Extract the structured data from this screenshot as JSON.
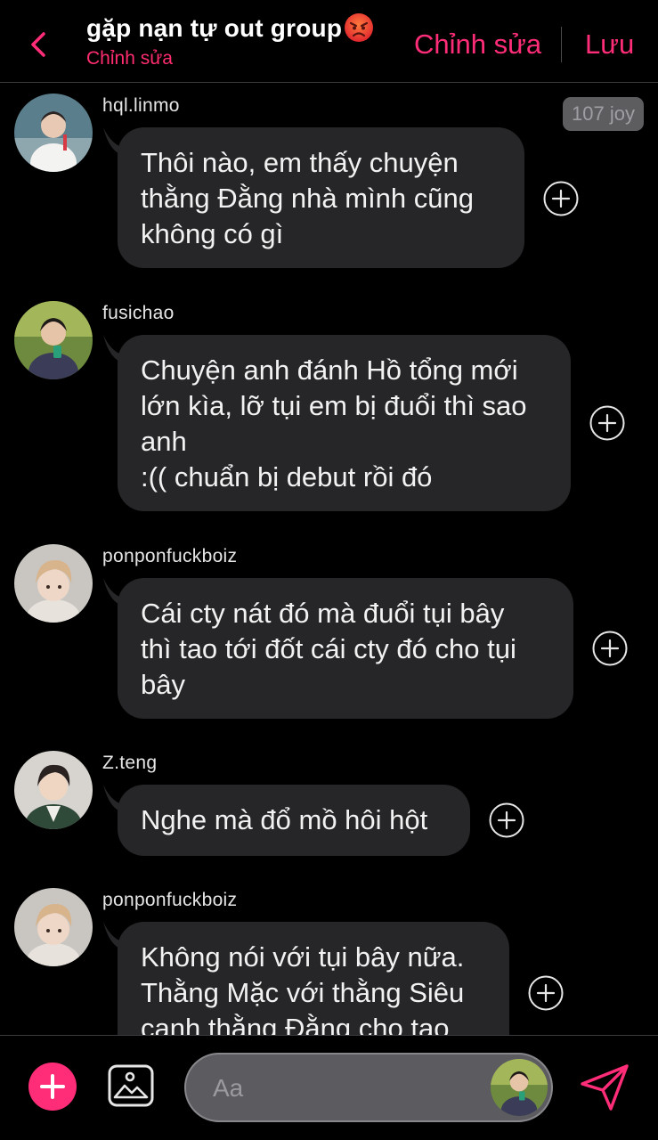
{
  "header": {
    "title": "gặp nạn tự out group",
    "title_emoji": "angry-face",
    "subtitle": "Chỉnh sửa",
    "edit_label": "Chỉnh sửa",
    "save_label": "Lưu",
    "accent_color": "#ff2d78"
  },
  "badge": {
    "label": "107 joy"
  },
  "messages": [
    {
      "username": "hql.linmo",
      "text": "Thôi nào, em thấy chuyện\nthằng Đằng nhà mình cũng\nkhông có gì",
      "avatar": "avatar-person-white-outfit-icon"
    },
    {
      "username": "fusichao",
      "text": "Chuyện anh đánh Hồ tổng mới\nlớn kìa, lỡ tụi em bị đuổi thì sao\nanh\n:(( chuẩn bị debut rồi đó",
      "avatar": "avatar-person-holding-drink-icon"
    },
    {
      "username": "ponponfuckboiz",
      "text": "Cái cty nát đó mà đuổi tụi bây\nthì tao tới đốt cái cty đó cho tụi\nbây",
      "avatar": "avatar-person-light-hair-icon"
    },
    {
      "username": "Z.teng",
      "text": "Nghe mà đổ mồ hôi hột",
      "avatar": "avatar-person-green-jacket-icon"
    },
    {
      "username": "ponponfuckboiz",
      "text": "Không nói với tụi bây nữa.\nThằng Mặc với thằng Siêu\ncanh thằng Đằng cho tao",
      "avatar": "avatar-person-light-hair-icon"
    }
  ],
  "composer": {
    "placeholder": "Aa"
  },
  "icons": {
    "back": "chevron-left-icon",
    "add_reaction": "plus-circle-icon",
    "plus": "plus-icon",
    "image": "image-icon",
    "send": "send-icon"
  }
}
